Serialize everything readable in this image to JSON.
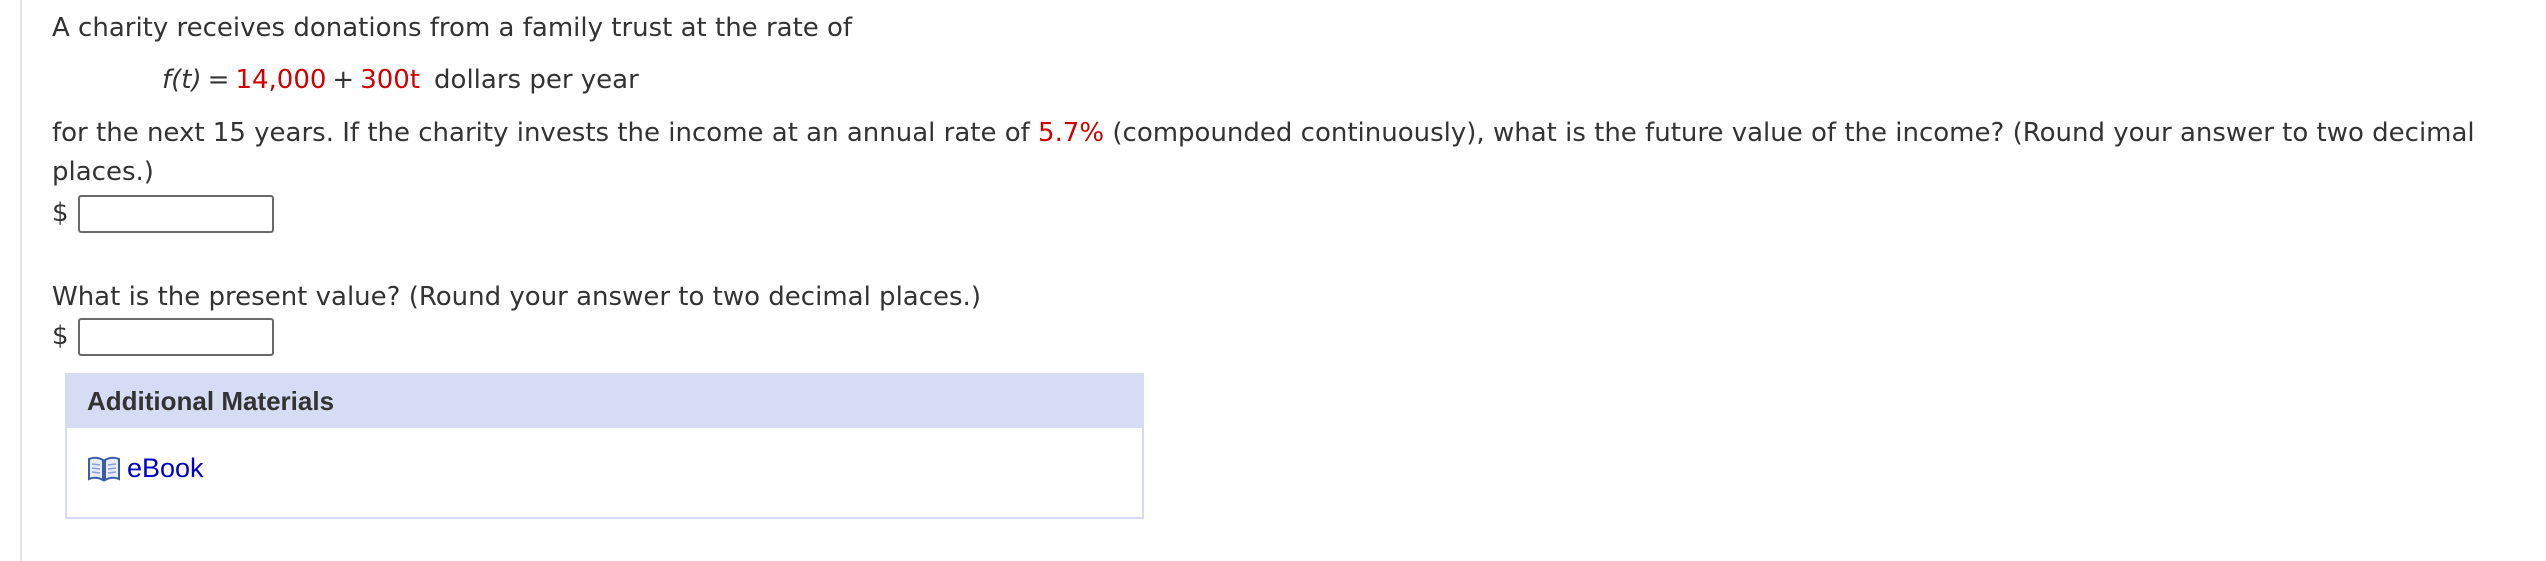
{
  "question": {
    "intro": "A charity receives donations from a family trust at the rate of",
    "formula": {
      "lhs": "f(t)",
      "equals": "=",
      "constant": "14,000",
      "plus": "+",
      "coefficient_term": "300t",
      "unit": "dollars per year"
    },
    "part1_text_a": "for the next 15 years. If the charity invests the income at an annual rate of ",
    "rate": "5.7%",
    "part1_text_b": " (compounded continuously), what is the future value of the income? (Round your answer to two decimal places.)",
    "currency_symbol_1": "$",
    "answer1_value": "",
    "part2_text": "What is the present value? (Round your answer to two decimal places.)",
    "currency_symbol_2": "$",
    "answer2_value": ""
  },
  "materials": {
    "header": "Additional Materials",
    "ebook_label": "eBook",
    "ebook_icon": "book-icon"
  },
  "colors": {
    "highlight": "#d00000",
    "panel_header_bg": "#d5dcf3",
    "link": "#0000cc"
  }
}
